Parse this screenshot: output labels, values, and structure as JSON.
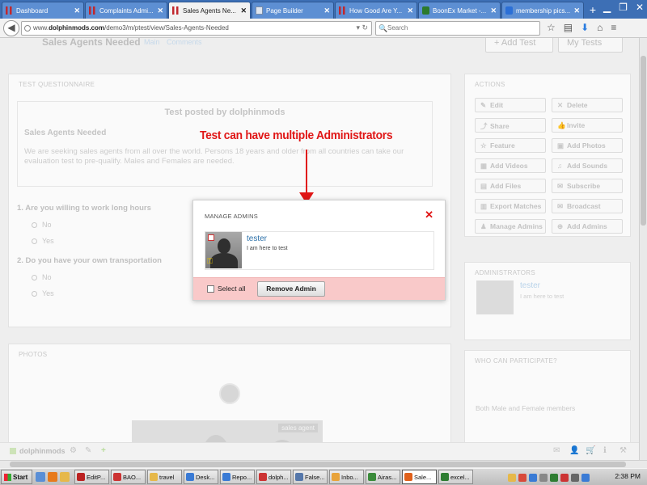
{
  "browser": {
    "tabs": [
      {
        "label": "Dashboard",
        "icon": "dolphin-red-icon",
        "active": false
      },
      {
        "label": "Complaints Admi...",
        "icon": "dolphin-red-icon",
        "active": false
      },
      {
        "label": "Sales Agents Ne...",
        "icon": "dolphin-red-icon",
        "active": true
      },
      {
        "label": "Page Builder",
        "icon": "page-icon",
        "active": false
      },
      {
        "label": "How Good Are Y...",
        "icon": "dolphin-red-icon",
        "active": false
      },
      {
        "label": "BoonEx Market -...",
        "icon": "boonex-green-icon",
        "active": false
      },
      {
        "label": "membership pics...",
        "icon": "google-icon",
        "active": false
      }
    ],
    "new_tab_glyph": "+",
    "url_prefix": "www.",
    "url_domain": "dolphinmods.com",
    "url_path": "/demo3/m/ptest/view/Sales-Agents-Needed",
    "search_placeholder": "Search",
    "search_glyph": "🔍",
    "back_glyph": "◀",
    "url_tools": "▾ ↻",
    "nav_glyphs": {
      "star": "☆",
      "reader": "▤",
      "download": "⬇",
      "home": "⌂",
      "menu": "≡"
    },
    "window_controls": {
      "minimize": "▁",
      "restore": "❐",
      "close": "✕"
    }
  },
  "page": {
    "header_title": "Sales Agents Needed",
    "header_links": [
      "Main",
      "Comments"
    ],
    "add_test_label": "+ Add Test",
    "my_tests_label": "My Tests",
    "questionnaire": {
      "title": "TEST QUESTIONNAIRE",
      "posted_by": "Test posted by dolphinmods",
      "test_name": "Sales Agents Needed",
      "description": "We are seeking sales agents from all over the world. Persons 18 years and older from all countries can take our evaluation test to pre-qualify. Males and Females are needed.",
      "questions": [
        {
          "text": "1. Are you willing to work long hours",
          "options": [
            "No",
            "Yes"
          ]
        },
        {
          "text": "2. Do you have your own transportation",
          "options": [
            "No",
            "Yes"
          ]
        }
      ]
    },
    "actions": {
      "title": "ACTIONS",
      "buttons": [
        {
          "label": "Edit",
          "icon": "✎"
        },
        {
          "label": "Delete",
          "icon": "✕"
        },
        {
          "label": "Share",
          "icon": "⤴"
        },
        {
          "label": "Invite",
          "icon": "👍"
        },
        {
          "label": "Feature",
          "icon": "☆"
        },
        {
          "label": "Add Photos",
          "icon": "▣"
        },
        {
          "label": "Add Videos",
          "icon": "▦"
        },
        {
          "label": "Add Sounds",
          "icon": "♫"
        },
        {
          "label": "Add Files",
          "icon": "▤"
        },
        {
          "label": "Subscribe",
          "icon": "✉"
        },
        {
          "label": "Export Matches",
          "icon": "▥"
        },
        {
          "label": "Broadcast",
          "icon": "✉"
        },
        {
          "label": "Manage Admins",
          "icon": "♟"
        },
        {
          "label": "Add Admins",
          "icon": "⊕"
        }
      ]
    },
    "administrators": {
      "title": "ADMINISTRATORS",
      "name": "tester",
      "bio": "I am here to test"
    },
    "participate": {
      "title": "WHO CAN PARTICIPATE?",
      "value": "Both Male and Female members"
    },
    "photos": {
      "title": "PHOTOS",
      "tag": "sales agent"
    },
    "footer": {
      "brand": "dolphinmods",
      "left_icons": {
        "gear": "⚙",
        "edit": "✎",
        "add": "+"
      },
      "right_icons": {
        "mail": "✉",
        "user": "👤",
        "cart": "🛒",
        "info": "ℹ",
        "tools": "⚒"
      }
    }
  },
  "annotation": {
    "text": "Test can have multiple Administrators",
    "color": "#e01616"
  },
  "modal": {
    "title": "MANAGE ADMINS",
    "close_glyph": "✕",
    "admin": {
      "name": "tester",
      "bio": "I am here to test",
      "key_glyph": "⚿"
    },
    "select_all_label": "Select all",
    "remove_button_label": "Remove Admin",
    "footer_color": "#f9c9c9"
  },
  "taskbar": {
    "start_label": "Start",
    "items": [
      {
        "label": "EditP...",
        "color": "#b22"
      },
      {
        "label": "BAO...",
        "color": "#c33"
      },
      {
        "label": "travel",
        "color": "#e6b84a"
      },
      {
        "label": "Desk...",
        "color": "#3a7bd5"
      },
      {
        "label": "Repo...",
        "color": "#3a7bd5"
      },
      {
        "label": "dolph...",
        "color": "#c33"
      },
      {
        "label": "False...",
        "color": "#5577aa"
      },
      {
        "label": "Inbo...",
        "color": "#e8a33a"
      },
      {
        "label": "Airas...",
        "color": "#3b8b3b"
      },
      {
        "label": "Sale...",
        "color": "#e0611c"
      },
      {
        "label": "excel...",
        "color": "#2e7d32"
      }
    ],
    "clock": "2:38 PM"
  }
}
